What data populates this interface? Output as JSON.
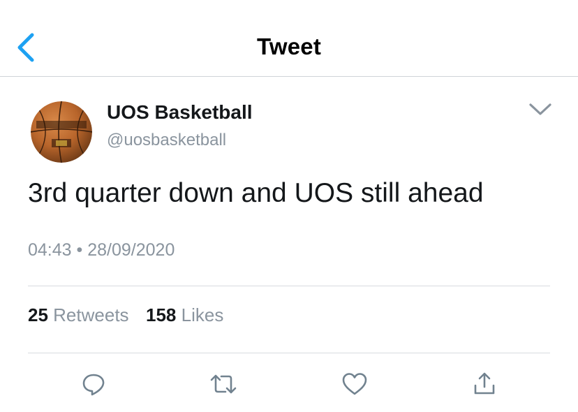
{
  "nav": {
    "title": "Tweet",
    "back_icon": "chevron-left-icon"
  },
  "tweet": {
    "author": {
      "display_name": "UOS Basketball",
      "handle": "@uosbasketball",
      "avatar": "basketball-avatar"
    },
    "text": "3rd quarter down and UOS still ahead",
    "time": "04:43",
    "separator": "•",
    "date": "28/09/2020",
    "stats": {
      "retweets_count": "25",
      "retweets_label": "Retweets",
      "likes_count": "158",
      "likes_label": "Likes"
    }
  },
  "actions": [
    {
      "name": "reply",
      "icon": "reply-icon"
    },
    {
      "name": "retweet",
      "icon": "retweet-icon"
    },
    {
      "name": "like",
      "icon": "heart-icon"
    },
    {
      "name": "share",
      "icon": "share-icon"
    }
  ],
  "colors": {
    "accent": "#1da1f2",
    "secondary_text": "#8a949e",
    "icon_gray": "#71828f",
    "divider": "#d7dbdf"
  }
}
